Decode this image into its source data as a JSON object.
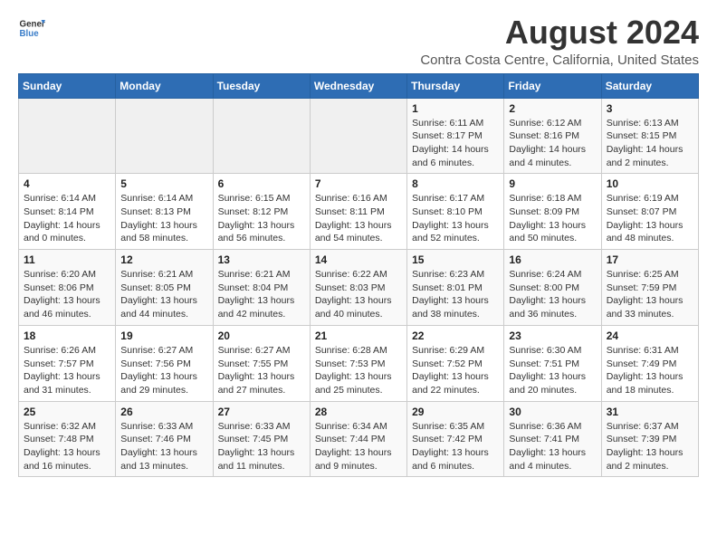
{
  "header": {
    "logo_general": "General",
    "logo_blue": "Blue",
    "main_title": "August 2024",
    "subtitle": "Contra Costa Centre, California, United States"
  },
  "calendar": {
    "days_of_week": [
      "Sunday",
      "Monday",
      "Tuesday",
      "Wednesday",
      "Thursday",
      "Friday",
      "Saturday"
    ],
    "weeks": [
      [
        {
          "day": "",
          "info": ""
        },
        {
          "day": "",
          "info": ""
        },
        {
          "day": "",
          "info": ""
        },
        {
          "day": "",
          "info": ""
        },
        {
          "day": "1",
          "info": "Sunrise: 6:11 AM\nSunset: 8:17 PM\nDaylight: 14 hours\nand 6 minutes."
        },
        {
          "day": "2",
          "info": "Sunrise: 6:12 AM\nSunset: 8:16 PM\nDaylight: 14 hours\nand 4 minutes."
        },
        {
          "day": "3",
          "info": "Sunrise: 6:13 AM\nSunset: 8:15 PM\nDaylight: 14 hours\nand 2 minutes."
        }
      ],
      [
        {
          "day": "4",
          "info": "Sunrise: 6:14 AM\nSunset: 8:14 PM\nDaylight: 14 hours\nand 0 minutes."
        },
        {
          "day": "5",
          "info": "Sunrise: 6:14 AM\nSunset: 8:13 PM\nDaylight: 13 hours\nand 58 minutes."
        },
        {
          "day": "6",
          "info": "Sunrise: 6:15 AM\nSunset: 8:12 PM\nDaylight: 13 hours\nand 56 minutes."
        },
        {
          "day": "7",
          "info": "Sunrise: 6:16 AM\nSunset: 8:11 PM\nDaylight: 13 hours\nand 54 minutes."
        },
        {
          "day": "8",
          "info": "Sunrise: 6:17 AM\nSunset: 8:10 PM\nDaylight: 13 hours\nand 52 minutes."
        },
        {
          "day": "9",
          "info": "Sunrise: 6:18 AM\nSunset: 8:09 PM\nDaylight: 13 hours\nand 50 minutes."
        },
        {
          "day": "10",
          "info": "Sunrise: 6:19 AM\nSunset: 8:07 PM\nDaylight: 13 hours\nand 48 minutes."
        }
      ],
      [
        {
          "day": "11",
          "info": "Sunrise: 6:20 AM\nSunset: 8:06 PM\nDaylight: 13 hours\nand 46 minutes."
        },
        {
          "day": "12",
          "info": "Sunrise: 6:21 AM\nSunset: 8:05 PM\nDaylight: 13 hours\nand 44 minutes."
        },
        {
          "day": "13",
          "info": "Sunrise: 6:21 AM\nSunset: 8:04 PM\nDaylight: 13 hours\nand 42 minutes."
        },
        {
          "day": "14",
          "info": "Sunrise: 6:22 AM\nSunset: 8:03 PM\nDaylight: 13 hours\nand 40 minutes."
        },
        {
          "day": "15",
          "info": "Sunrise: 6:23 AM\nSunset: 8:01 PM\nDaylight: 13 hours\nand 38 minutes."
        },
        {
          "day": "16",
          "info": "Sunrise: 6:24 AM\nSunset: 8:00 PM\nDaylight: 13 hours\nand 36 minutes."
        },
        {
          "day": "17",
          "info": "Sunrise: 6:25 AM\nSunset: 7:59 PM\nDaylight: 13 hours\nand 33 minutes."
        }
      ],
      [
        {
          "day": "18",
          "info": "Sunrise: 6:26 AM\nSunset: 7:57 PM\nDaylight: 13 hours\nand 31 minutes."
        },
        {
          "day": "19",
          "info": "Sunrise: 6:27 AM\nSunset: 7:56 PM\nDaylight: 13 hours\nand 29 minutes."
        },
        {
          "day": "20",
          "info": "Sunrise: 6:27 AM\nSunset: 7:55 PM\nDaylight: 13 hours\nand 27 minutes."
        },
        {
          "day": "21",
          "info": "Sunrise: 6:28 AM\nSunset: 7:53 PM\nDaylight: 13 hours\nand 25 minutes."
        },
        {
          "day": "22",
          "info": "Sunrise: 6:29 AM\nSunset: 7:52 PM\nDaylight: 13 hours\nand 22 minutes."
        },
        {
          "day": "23",
          "info": "Sunrise: 6:30 AM\nSunset: 7:51 PM\nDaylight: 13 hours\nand 20 minutes."
        },
        {
          "day": "24",
          "info": "Sunrise: 6:31 AM\nSunset: 7:49 PM\nDaylight: 13 hours\nand 18 minutes."
        }
      ],
      [
        {
          "day": "25",
          "info": "Sunrise: 6:32 AM\nSunset: 7:48 PM\nDaylight: 13 hours\nand 16 minutes."
        },
        {
          "day": "26",
          "info": "Sunrise: 6:33 AM\nSunset: 7:46 PM\nDaylight: 13 hours\nand 13 minutes."
        },
        {
          "day": "27",
          "info": "Sunrise: 6:33 AM\nSunset: 7:45 PM\nDaylight: 13 hours\nand 11 minutes."
        },
        {
          "day": "28",
          "info": "Sunrise: 6:34 AM\nSunset: 7:44 PM\nDaylight: 13 hours\nand 9 minutes."
        },
        {
          "day": "29",
          "info": "Sunrise: 6:35 AM\nSunset: 7:42 PM\nDaylight: 13 hours\nand 6 minutes."
        },
        {
          "day": "30",
          "info": "Sunrise: 6:36 AM\nSunset: 7:41 PM\nDaylight: 13 hours\nand 4 minutes."
        },
        {
          "day": "31",
          "info": "Sunrise: 6:37 AM\nSunset: 7:39 PM\nDaylight: 13 hours\nand 2 minutes."
        }
      ]
    ]
  }
}
